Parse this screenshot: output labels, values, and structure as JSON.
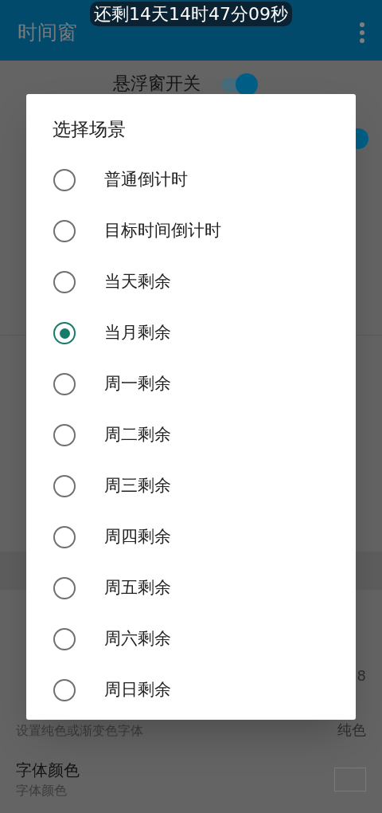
{
  "countdown_pill": "还剩14天14时47分09秒",
  "app_bar": {
    "title": "时间窗"
  },
  "floating_switch": {
    "label": "悬浮窗开关",
    "on": true
  },
  "settings": [
    {
      "toggle_on": true
    },
    {
      "value": "8"
    },
    {
      "subtitle": "设置纯色或渐变色字体",
      "value": "纯色"
    },
    {
      "title": "字体颜色",
      "subtitle": "字体颜色",
      "swatch": true
    }
  ],
  "dialog": {
    "title": "选择场景",
    "options": [
      {
        "label": "普通倒计时",
        "selected": false
      },
      {
        "label": "目标时间倒计时",
        "selected": false
      },
      {
        "label": "当天剩余",
        "selected": false
      },
      {
        "label": "当月剩余",
        "selected": true
      },
      {
        "label": "周一剩余",
        "selected": false
      },
      {
        "label": "周二剩余",
        "selected": false
      },
      {
        "label": "周三剩余",
        "selected": false
      },
      {
        "label": "周四剩余",
        "selected": false
      },
      {
        "label": "周五剩余",
        "selected": false
      },
      {
        "label": "周六剩余",
        "selected": false
      },
      {
        "label": "周日剩余",
        "selected": false
      }
    ]
  }
}
